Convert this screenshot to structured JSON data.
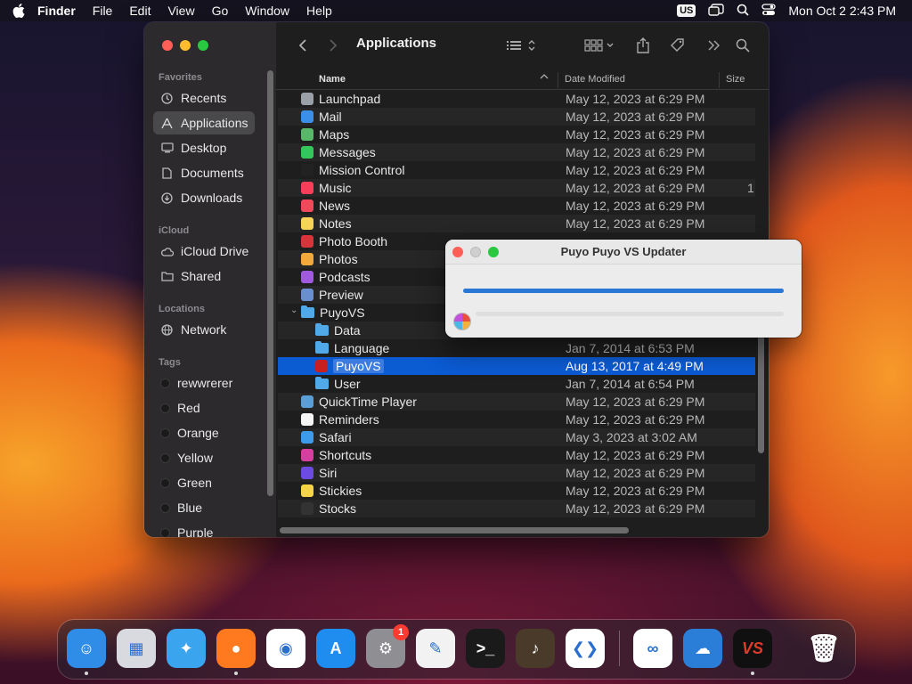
{
  "menubar": {
    "app_name": "Finder",
    "menus": [
      "File",
      "Edit",
      "View",
      "Go",
      "Window",
      "Help"
    ],
    "input_source": "US",
    "datetime": "Mon Oct 2  2:43 PM"
  },
  "finder": {
    "title": "Applications",
    "sidebar": {
      "favorites_header": "Favorites",
      "favorites": [
        {
          "label": "Recents",
          "icon": "clock-icon"
        },
        {
          "label": "Applications",
          "icon": "applications-icon"
        },
        {
          "label": "Desktop",
          "icon": "desktop-icon"
        },
        {
          "label": "Documents",
          "icon": "document-icon"
        },
        {
          "label": "Downloads",
          "icon": "download-icon"
        }
      ],
      "icloud_header": "iCloud",
      "icloud": [
        {
          "label": "iCloud Drive",
          "icon": "cloud-icon"
        },
        {
          "label": "Shared",
          "icon": "shared-folder-icon"
        }
      ],
      "locations_header": "Locations",
      "locations": [
        {
          "label": "Network",
          "icon": "network-icon"
        }
      ],
      "tags_header": "Tags",
      "tags": [
        "rewwrerer",
        "Red",
        "Orange",
        "Yellow",
        "Green",
        "Blue",
        "Purple"
      ]
    },
    "columns": {
      "name": "Name",
      "date": "Date Modified",
      "size": "Size"
    },
    "rows": [
      {
        "name": "Launchpad",
        "date": "May 12, 2023 at 6:29 PM",
        "size": "",
        "icon_color": "#9aa0a8"
      },
      {
        "name": "Mail",
        "date": "May 12, 2023 at 6:29 PM",
        "size": "",
        "icon_color": "#3b8fe6"
      },
      {
        "name": "Maps",
        "date": "May 12, 2023 at 6:29 PM",
        "size": "",
        "icon_color": "#58b86a"
      },
      {
        "name": "Messages",
        "date": "May 12, 2023 at 6:29 PM",
        "size": "",
        "icon_color": "#34c759"
      },
      {
        "name": "Mission Control",
        "date": "May 12, 2023 at 6:29 PM",
        "size": "",
        "icon_color": "#222222"
      },
      {
        "name": "Music",
        "date": "May 12, 2023 at 6:29 PM",
        "size": "1",
        "icon_color": "#fa3e5a"
      },
      {
        "name": "News",
        "date": "May 12, 2023 at 6:29 PM",
        "size": "",
        "icon_color": "#f04a5a"
      },
      {
        "name": "Notes",
        "date": "May 12, 2023 at 6:29 PM",
        "size": "",
        "icon_color": "#f7d358"
      },
      {
        "name": "Photo Booth",
        "date": "",
        "size": "",
        "icon_color": "#d8353a"
      },
      {
        "name": "Photos",
        "date": "",
        "size": "",
        "icon_color": "#f2a93b"
      },
      {
        "name": "Podcasts",
        "date": "",
        "size": "",
        "icon_color": "#a05ae0"
      },
      {
        "name": "Preview",
        "date": "",
        "size": "",
        "icon_color": "#6a8fd0"
      },
      {
        "name": "PuyoVS",
        "date": "",
        "size": "",
        "folder": true,
        "expanded": true
      },
      {
        "name": "Data",
        "date": "",
        "size": "",
        "folder": true,
        "indent": true
      },
      {
        "name": "Language",
        "date": "Jan 7, 2014 at 6:53 PM",
        "size": "",
        "folder": true,
        "indent": true
      },
      {
        "name": "PuyoVS",
        "date": "Aug 13, 2017 at 4:49 PM",
        "size": "",
        "indent": true,
        "selected": true,
        "icon_color": "#c8201e"
      },
      {
        "name": "User",
        "date": "Jan 7, 2014 at 6:54 PM",
        "size": "",
        "folder": true,
        "indent": true
      },
      {
        "name": "QuickTime Player",
        "date": "May 12, 2023 at 6:29 PM",
        "size": "",
        "icon_color": "#5a9fd8"
      },
      {
        "name": "Reminders",
        "date": "May 12, 2023 at 6:29 PM",
        "size": "",
        "icon_color": "#f5f5f5"
      },
      {
        "name": "Safari",
        "date": "May 3, 2023 at 3:02 AM",
        "size": "",
        "icon_color": "#3d9be9"
      },
      {
        "name": "Shortcuts",
        "date": "May 12, 2023 at 6:29 PM",
        "size": "",
        "icon_color": "#d63fa0"
      },
      {
        "name": "Siri",
        "date": "May 12, 2023 at 6:29 PM",
        "size": "",
        "icon_color": "#6b4be0"
      },
      {
        "name": "Stickies",
        "date": "May 12, 2023 at 6:29 PM",
        "size": "",
        "icon_color": "#f5d547"
      },
      {
        "name": "Stocks",
        "date": "May 12, 2023 at 6:29 PM",
        "size": "",
        "icon_color": "#333333"
      }
    ]
  },
  "updater": {
    "title": "Puyo Puyo VS Updater",
    "progress_fraction": 1.0
  },
  "dock": {
    "apps": [
      {
        "name": "finder-icon",
        "running": true,
        "color": "#2f8de8",
        "glyph": "☺"
      },
      {
        "name": "launchpad-icon",
        "running": false,
        "color": "#d9d9e0",
        "glyph": "▦"
      },
      {
        "name": "safari-icon",
        "running": false,
        "color": "#3ba4ee",
        "glyph": "✦"
      },
      {
        "name": "firefox-icon",
        "running": true,
        "color": "#ff7a1f",
        "glyph": "●"
      },
      {
        "name": "chrome-icon",
        "running": false,
        "color": "#ffffff",
        "glyph": "◉"
      },
      {
        "name": "app-store-icon",
        "running": false,
        "color": "#1f8cf0",
        "glyph": "A"
      },
      {
        "name": "system-settings-icon",
        "running": false,
        "color": "#8e8e93",
        "glyph": "⚙",
        "badge": "1"
      },
      {
        "name": "textedit-icon",
        "running": false,
        "color": "#f2f2f2",
        "glyph": "✎"
      },
      {
        "name": "terminal-icon",
        "running": false,
        "color": "#1a1a1a",
        "glyph": ">_"
      },
      {
        "name": "garageband-icon",
        "running": false,
        "color": "#4a3a2a",
        "glyph": "♪"
      },
      {
        "name": "vscode-icon",
        "running": false,
        "color": "#ffffff",
        "glyph": "❮❯"
      },
      {
        "name": "visual-studio-icon",
        "running": false,
        "color": "#ffffff",
        "glyph": "∞"
      },
      {
        "name": "weather-icon",
        "running": false,
        "color": "#2b7ed8",
        "glyph": "☁"
      },
      {
        "name": "puyovs-icon",
        "running": true,
        "color": "#101010",
        "glyph": "VS"
      },
      {
        "name": "trash-icon",
        "running": false,
        "color": "transparent",
        "glyph": "🗑"
      }
    ]
  }
}
